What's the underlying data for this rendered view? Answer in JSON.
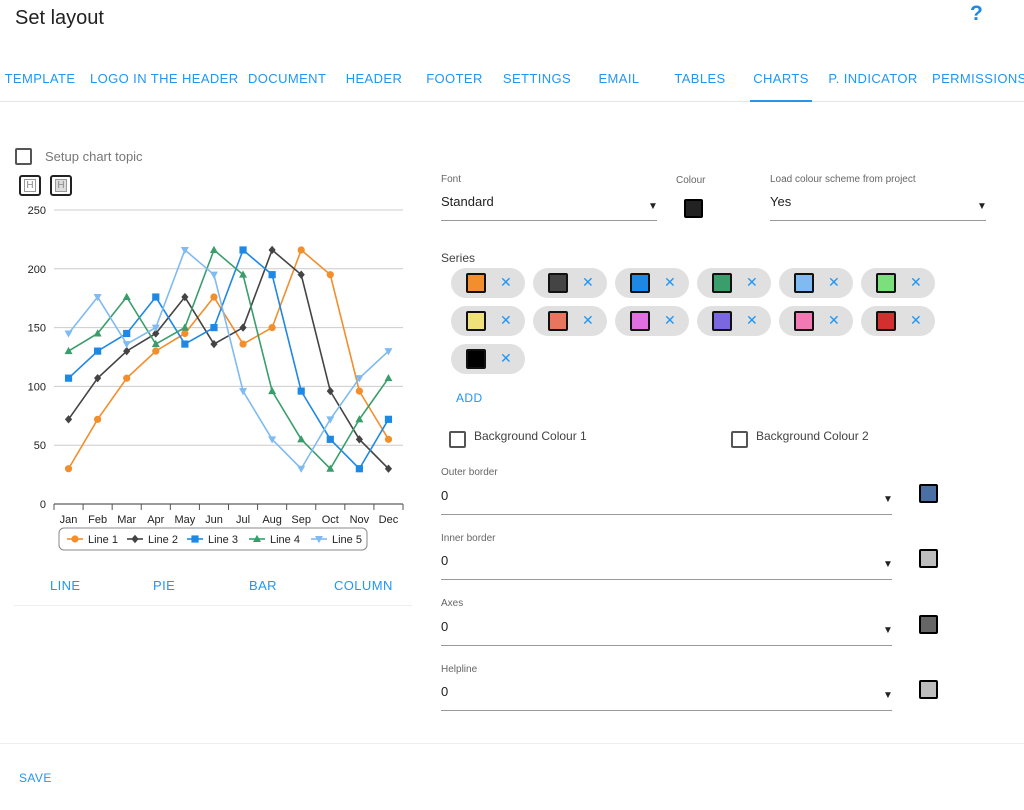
{
  "page": {
    "title": "Set layout",
    "help": "?"
  },
  "tabs": [
    {
      "label": "TEMPLATE"
    },
    {
      "label": "LOGO IN THE HEADER"
    },
    {
      "label": "DOCUMENT"
    },
    {
      "label": "HEADER"
    },
    {
      "label": "FOOTER"
    },
    {
      "label": "SETTINGS"
    },
    {
      "label": "EMAIL"
    },
    {
      "label": "TABLES"
    },
    {
      "label": "CHARTS"
    },
    {
      "label": "P. INDICATOR"
    },
    {
      "label": "PERMISSIONS"
    }
  ],
  "active_tab": "CHARTS",
  "chart_topic": {
    "label": "Setup chart topic",
    "checked": false
  },
  "heading_buttons": [
    {
      "glyph": "H"
    },
    {
      "glyph": "H"
    }
  ],
  "chart_data": {
    "type": "line",
    "title": "",
    "categories": [
      "Jan",
      "Feb",
      "Mar",
      "Apr",
      "May",
      "Jun",
      "Jul",
      "Aug",
      "Sep",
      "Oct",
      "Nov",
      "Dec"
    ],
    "ylim": [
      0,
      250
    ],
    "yticks": [
      0,
      50,
      100,
      150,
      200,
      250
    ],
    "grid": true,
    "legend": "bottom",
    "series": [
      {
        "name": "Line 1",
        "color": "#f28e2b",
        "marker": "circle",
        "values": [
          30,
          72,
          107,
          130,
          145,
          176,
          136,
          150,
          216,
          195,
          96,
          55
        ]
      },
      {
        "name": "Line 2",
        "color": "#444444",
        "marker": "diamond",
        "values": [
          72,
          107,
          130,
          145,
          176,
          136,
          150,
          216,
          195,
          96,
          55,
          30
        ]
      },
      {
        "name": "Line 3",
        "color": "#1e88e5",
        "marker": "square",
        "values": [
          107,
          130,
          145,
          176,
          136,
          150,
          216,
          195,
          96,
          55,
          30,
          72
        ]
      },
      {
        "name": "Line 4",
        "color": "#3a9e6c",
        "marker": "triangle",
        "values": [
          130,
          145,
          176,
          136,
          150,
          216,
          195,
          96,
          55,
          30,
          72,
          107
        ]
      },
      {
        "name": "Line 5",
        "color": "#7fbbf0",
        "marker": "triangle-down",
        "values": [
          145,
          176,
          136,
          150,
          216,
          195,
          96,
          55,
          30,
          72,
          107,
          130
        ]
      }
    ]
  },
  "chart_types": [
    {
      "label": "LINE"
    },
    {
      "label": "PIE"
    },
    {
      "label": "BAR"
    },
    {
      "label": "COLUMN"
    }
  ],
  "font": {
    "label": "Font",
    "value": "Standard"
  },
  "colour": {
    "label": "Colour",
    "value": "#222222"
  },
  "scheme": {
    "label": "Load colour scheme from project",
    "value": "Yes"
  },
  "series_section": {
    "title": "Series",
    "remove_glyph": "✕",
    "colors": [
      "#f28e2b",
      "#444444",
      "#1e88e5",
      "#3a9e6c",
      "#7fbbf0",
      "#7be07b",
      "#f0e27a",
      "#e8765e",
      "#e070e0",
      "#7b68e0",
      "#f27ab4",
      "#d32f2f",
      "#000000"
    ]
  },
  "add_label": "ADD",
  "background_colour_1": {
    "label": "Background Colour 1",
    "checked": false
  },
  "background_colour_2": {
    "label": "Background Colour 2",
    "checked": false
  },
  "borders": [
    {
      "label": "Outer border",
      "value": "0",
      "color": "#4a6fa5"
    },
    {
      "label": "Inner border",
      "value": "0",
      "color": "#bdbdbd"
    },
    {
      "label": "Axes",
      "value": "0",
      "color": "#666666"
    },
    {
      "label": "Helpline",
      "value": "0",
      "color": "#bdbdbd"
    }
  ],
  "save_label": "SAVE"
}
